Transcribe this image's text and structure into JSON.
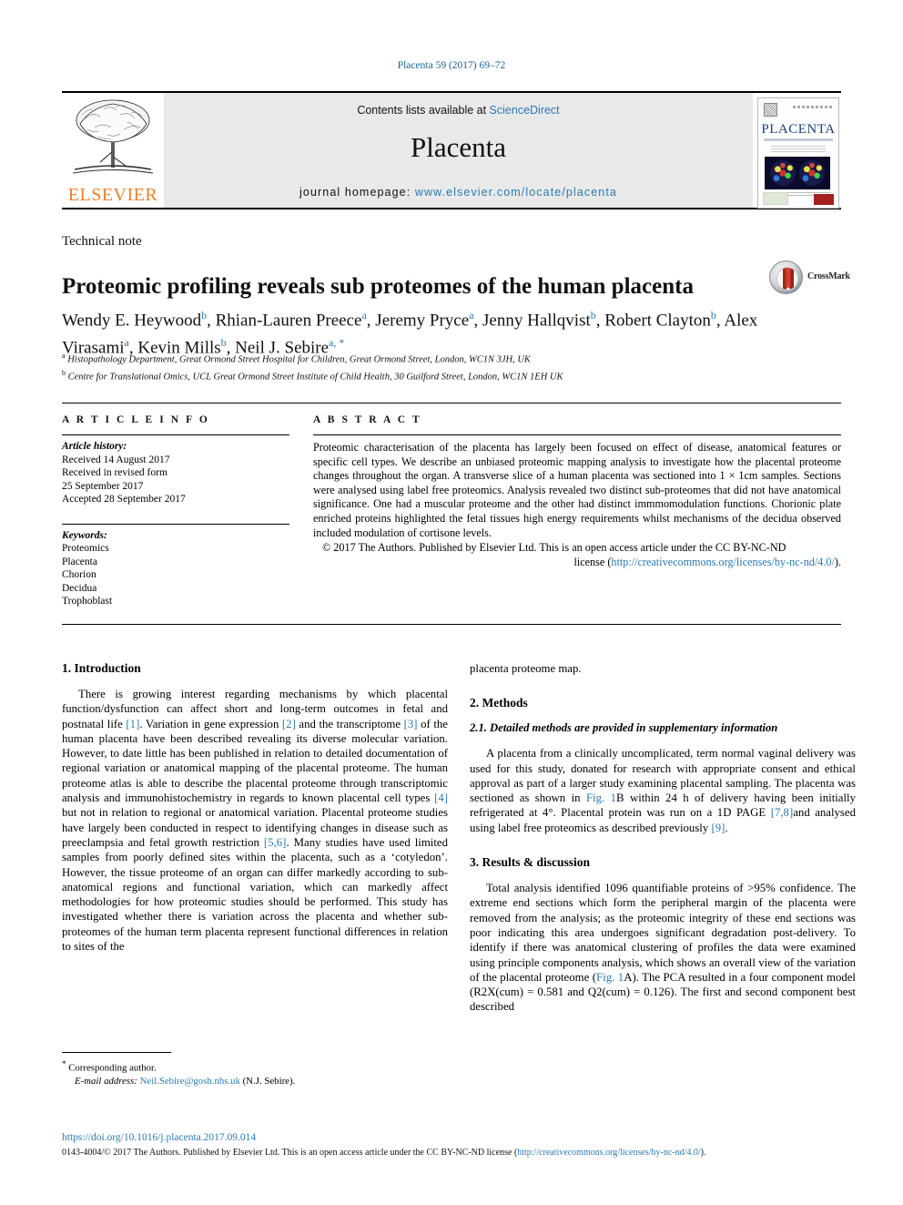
{
  "running_head": "Placenta 59 (2017) 69–72",
  "masthead": {
    "publisher": "ELSEVIER",
    "contents_prefix": "Contents lists available at ",
    "contents_link": "ScienceDirect",
    "journal_title": "Placenta",
    "homepage_prefix": "journal homepage: ",
    "homepage_url": "www.elsevier.com/locate/placenta",
    "cover_title": "PLACENTA"
  },
  "article": {
    "type": "Technical note",
    "title": "Proteomic profiling reveals sub proteomes of the human placenta",
    "crossmark_label": "CrossMark",
    "authors": [
      {
        "name": "Wendy E. Heywood",
        "marks": "b",
        "sep": ", "
      },
      {
        "name": "Rhian-Lauren Preece",
        "marks": "a",
        "sep": ", "
      },
      {
        "name": "Jeremy Pryce",
        "marks": "a",
        "sep": ", "
      },
      {
        "name": "Jenny Hallqvist",
        "marks": "b",
        "sep": ", "
      },
      {
        "name": "Robert Clayton",
        "marks": "b",
        "sep": ", "
      },
      {
        "name": "Alex Virasami",
        "marks": "a",
        "sep": ", "
      },
      {
        "name": "Kevin Mills",
        "marks": "b",
        "sep": ", "
      },
      {
        "name": "Neil J. Sebire",
        "marks": "a, *",
        "sep": ""
      }
    ],
    "affiliations": [
      {
        "mark": "a",
        "text": "Histopathology Department, Great Ormond Street Hospital for Children, Great Ormond Street, London, WC1N 3JH, UK"
      },
      {
        "mark": "b",
        "text": "Centre for Translational Omics, UCL Great Ormond Street Institute of Child Health, 30 Guilford Street, London, WC1N 1EH UK"
      }
    ]
  },
  "article_info": {
    "heading": "A R T I C L E   I N F O",
    "history_label": "Article history:",
    "history": [
      "Received 14 August 2017",
      "Received in revised form",
      "25 September 2017",
      "Accepted 28 September 2017"
    ],
    "keywords_label": "Keywords:",
    "keywords": [
      "Proteomics",
      "Placenta",
      "Chorion",
      "Decidua",
      "Trophoblast"
    ]
  },
  "abstract": {
    "heading": "A B S T R A C T",
    "body": "Proteomic characterisation of the placenta has largely been focused on effect of disease, anatomical features or specific cell types. We describe an unbiased proteomic mapping analysis to investigate how the placental proteome changes throughout the organ. A transverse slice of a human placenta was sectioned into 1 × 1cm samples. Sections were analysed using label free proteomics. Analysis revealed two distinct sub-proteomes that did not have anatomical significance. One had a muscular proteome and the other had distinct immmomodulation functions. Chorionic plate enriched proteins highlighted the fetal tissues high energy requirements whilst mechanisms of the decidua observed included modulation of cortisone levels.",
    "copyright": "© 2017 The Authors. Published by Elsevier Ltd. This is an open access article under the CC BY-NC-ND",
    "license_prefix": "license (",
    "license_url": "http://creativecommons.org/licenses/by-nc-nd/4.0/",
    "license_suffix": ").",
    "copyright_note": "© 2017 The Authors. Published by Elsevier Ltd. This is an open access article under the CC BY-NC-ND license (http://creativecommons.org/licenses/by-nc-nd/4.0/)."
  },
  "body": {
    "intro_heading": "1. Introduction",
    "intro_p1_a": "There is growing interest regarding mechanisms by which placental function/dysfunction can affect short and long-term outcomes in fetal and postnatal life ",
    "intro_p1_r1": "[1]",
    "intro_p1_b": ". Variation in gene expression ",
    "intro_p1_r2": "[2]",
    "intro_p1_c": " and the transcriptome ",
    "intro_p1_r3": "[3]",
    "intro_p1_d": " of the human placenta have been described revealing its diverse molecular variation. However, to date little has been published in relation to detailed documentation of regional variation or anatomical mapping of the placental proteome. The human proteome atlas is able to describe the placental proteome through transcriptomic analysis and immunohistochemistry in regards to known placental cell types ",
    "intro_p1_r4": "[4]",
    "intro_p1_e": " but not in relation to regional or anatomical variation. Placental proteome studies have largely been conducted in respect to identifying changes in disease such as preeclampsia and fetal growth restriction ",
    "intro_p1_r5": "[5,6]",
    "intro_p1_f": ". Many studies have used limited samples from poorly defined sites within the placenta, such as a ‘cotyledon’. However, the tissue proteome of an organ can differ markedly according to sub-anatomical regions and functional variation, which can markedly affect methodologies for how proteomic studies should be performed. This study has investigated whether there is variation across the placenta and whether sub-proteomes of the human term placenta represent functional differences in relation to sites of the",
    "right_continuation": "placenta proteome map.",
    "methods_heading": "2. Methods",
    "methods_sub_heading": "2.1. Detailed methods are provided in supplementary information",
    "methods_p_a": "A placenta from a clinically uncomplicated, term normal vaginal delivery was used for this study, donated for research with appropriate consent and ethical approval as part of a larger study examining placental sampling. The placenta was sectioned as shown in ",
    "methods_p_fig": "Fig. 1",
    "methods_p_b": "B within 24 h of delivery having been initially refrigerated at 4°. Placental protein was run on a 1D PAGE ",
    "methods_p_r1": "[7,8]",
    "methods_p_c": "and analysed using label free proteomics as described previously ",
    "methods_p_r2": "[9]",
    "methods_p_d": ".",
    "results_heading": "3. Results & discussion",
    "results_p_a": "Total analysis identified 1096 quantifiable proteins of >95% confidence. The extreme end sections which form the peripheral margin of the placenta were removed from the analysis; as the proteomic integrity of these end sections was poor indicating this area undergoes significant degradation post-delivery. To identify if there was anatomical clustering of profiles the data were examined using principle components analysis, which shows an overall view of the variation of the placental proteome (",
    "results_p_fig": "Fig. 1",
    "results_p_b": "A). The PCA resulted in a four component model (R2X(cum) = 0.581 and Q2(cum) = 0.126). The first and second component best described"
  },
  "footnote": {
    "star": "*",
    "corresponding": " Corresponding author.",
    "email_label": "E-mail address:",
    "email": "Neil.Sebire@gosh.nhs.uk",
    "email_owner": " (N.J. Sebire)."
  },
  "footer": {
    "doi": "https://doi.org/10.1016/j.placenta.2017.09.014",
    "issn_text": "0143-4004/© 2017 The Authors. Published by Elsevier Ltd. This is an open access article under the CC BY-NC-ND license (",
    "issn_link": "http://creativecommons.org/licenses/by-nc-nd/4.0/",
    "issn_suffix": ")."
  },
  "colors": {
    "link": "#2a7ab0",
    "elsevier_orange": "#F07E26",
    "masthead_grey": "#e9e9e9"
  }
}
